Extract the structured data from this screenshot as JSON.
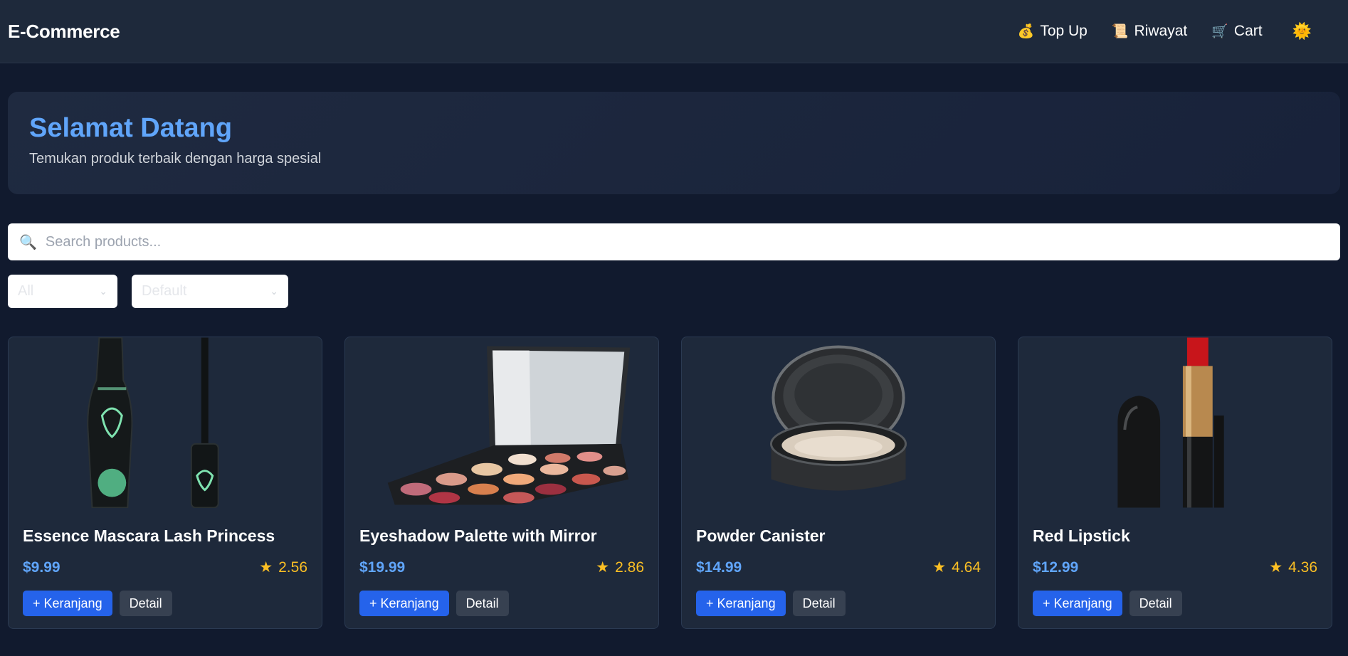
{
  "navbar": {
    "brand": "E-Commerce",
    "links": [
      {
        "icon": "money-bag-icon",
        "glyph": "💰",
        "label": "Top Up"
      },
      {
        "icon": "scroll-icon",
        "glyph": "📜",
        "label": "Riwayat"
      },
      {
        "icon": "cart-icon",
        "glyph": "🛒",
        "label": "Cart"
      }
    ],
    "theme_glyph": "🌞"
  },
  "hero": {
    "title": "Selamat Datang",
    "subtitle": "Temukan produk terbaik dengan harga spesial"
  },
  "search": {
    "placeholder": "Search products...",
    "value": ""
  },
  "filters": {
    "category_selected": "All",
    "sort_selected": "Default"
  },
  "products": [
    {
      "name": "Essence Mascara Lash Princess",
      "price": "$9.99",
      "rating": "2.56",
      "add_label": "+ Keranjang",
      "detail_label": "Detail"
    },
    {
      "name": "Eyeshadow Palette with Mirror",
      "price": "$19.99",
      "rating": "2.86",
      "add_label": "+ Keranjang",
      "detail_label": "Detail"
    },
    {
      "name": "Powder Canister",
      "price": "$14.99",
      "rating": "4.64",
      "add_label": "+ Keranjang",
      "detail_label": "Detail"
    },
    {
      "name": "Red Lipstick",
      "price": "$12.99",
      "rating": "4.36",
      "add_label": "+ Keranjang",
      "detail_label": "Detail"
    }
  ],
  "colors": {
    "accent": "#60a5fa",
    "button_primary": "#2563eb",
    "star": "#fbbf24",
    "background": "#111a2e",
    "card": "#1e293b"
  }
}
